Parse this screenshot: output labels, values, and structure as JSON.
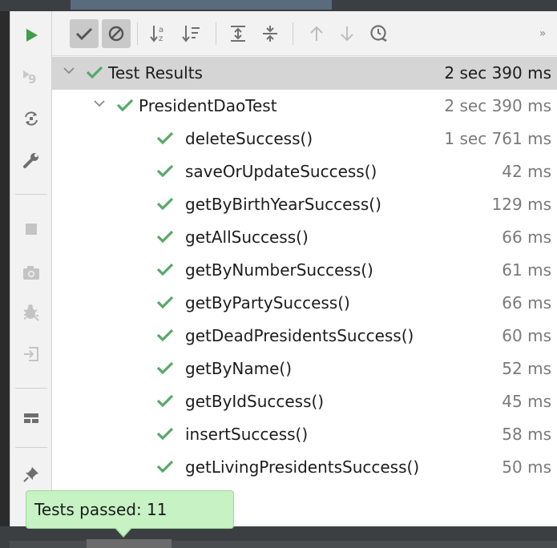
{
  "toolbar": {
    "buttons": [
      {
        "icon": "show-passed-check-icon",
        "active": true
      },
      {
        "icon": "show-ignored-icon",
        "active": true
      },
      {
        "icon": "sort-alphabetically-icon"
      },
      {
        "icon": "sort-by-duration-icon"
      },
      {
        "icon": "expand-all-icon"
      },
      {
        "icon": "collapse-all-icon"
      },
      {
        "icon": "previous-failed-arrow-up-icon"
      },
      {
        "icon": "next-failed-arrow-down-icon"
      },
      {
        "icon": "test-history-clock-icon"
      }
    ],
    "overflow": "»"
  },
  "leftbar": {
    "buttons": [
      {
        "icon": "rerun-play-icon"
      },
      {
        "icon": "rerun-failed-icon"
      },
      {
        "icon": "toggle-auto-test-icon"
      },
      {
        "icon": "settings-wrench-icon"
      },
      {
        "icon": "stop-icon"
      },
      {
        "icon": "screenshot-camera-icon"
      },
      {
        "icon": "debug-bug-icon"
      },
      {
        "icon": "export-icon"
      },
      {
        "icon": "layout-icon"
      },
      {
        "icon": "pin-icon"
      }
    ]
  },
  "tree": {
    "root": {
      "name": "Test Results",
      "duration": "2 sec 390 ms"
    },
    "suite": {
      "name": "PresidentDaoTest",
      "duration": "2 sec 390 ms"
    },
    "tests": [
      {
        "name": "deleteSuccess()",
        "duration": "1 sec 761 ms"
      },
      {
        "name": "saveOrUpdateSuccess()",
        "duration": "42 ms"
      },
      {
        "name": "getByBirthYearSuccess()",
        "duration": "129 ms"
      },
      {
        "name": "getAllSuccess()",
        "duration": "66 ms"
      },
      {
        "name": "getByNumberSuccess()",
        "duration": "61 ms"
      },
      {
        "name": "getByPartySuccess()",
        "duration": "66 ms"
      },
      {
        "name": "getDeadPresidentsSuccess()",
        "duration": "60 ms"
      },
      {
        "name": "getByName()",
        "duration": "52 ms"
      },
      {
        "name": "getByIdSuccess()",
        "duration": "45 ms"
      },
      {
        "name": "insertSuccess()",
        "duration": "58 ms"
      },
      {
        "name": "getLivingPresidentsSuccess()",
        "duration": "50 ms"
      }
    ]
  },
  "tooltip": {
    "text": "Tests passed: 11"
  },
  "colors": {
    "pass_green": "#59a869",
    "run_green": "#3f9e4a",
    "tooltip_bg": "#c7f2c4"
  }
}
